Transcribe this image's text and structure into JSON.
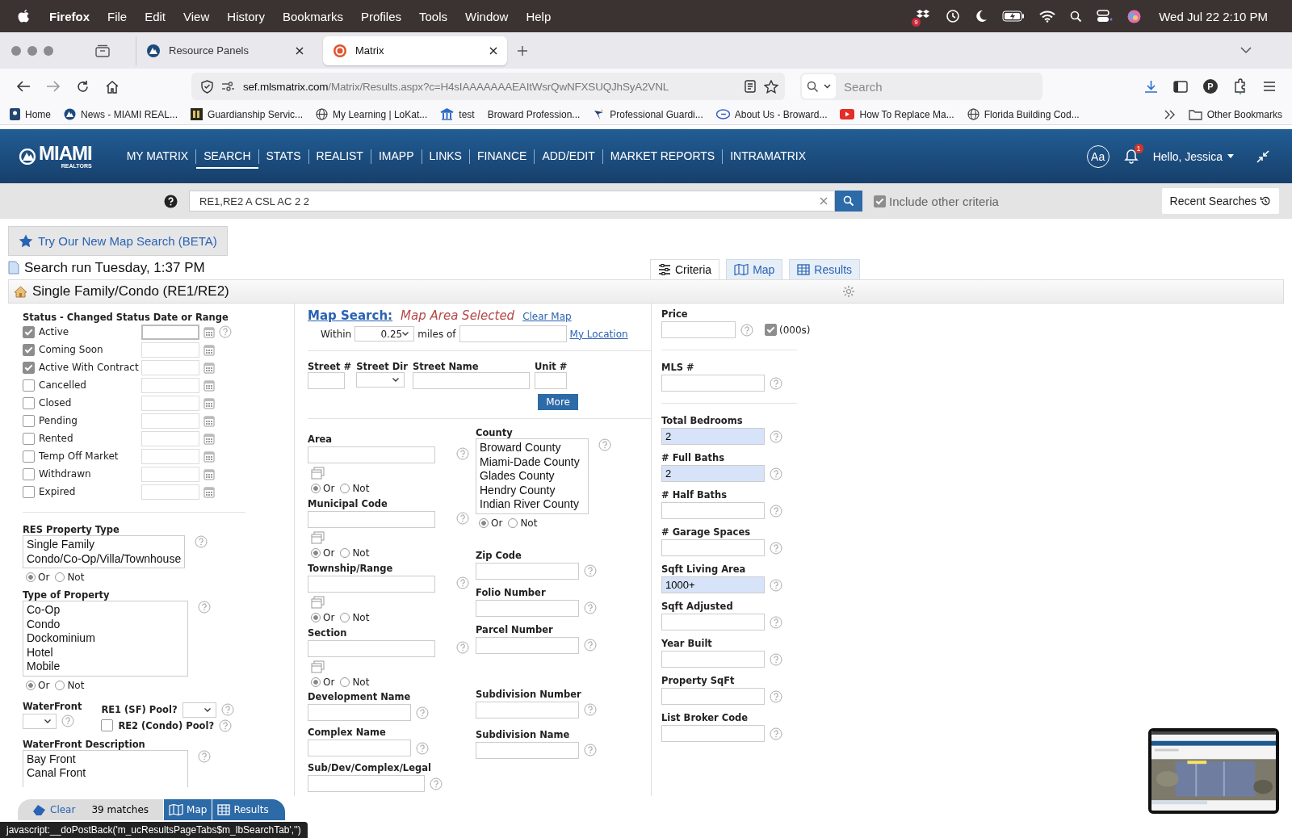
{
  "menubar": {
    "app": "Firefox",
    "menus": [
      "File",
      "Edit",
      "View",
      "History",
      "Bookmarks",
      "Profiles",
      "Tools",
      "Window",
      "Help"
    ],
    "dropbox_badge": "9",
    "clock": "Wed Jul 22  2:10 PM"
  },
  "tabs": [
    {
      "title": "Resource Panels",
      "selected": false
    },
    {
      "title": "Matrix",
      "selected": true
    }
  ],
  "address": {
    "domain": "sef.mlsmatrix.com",
    "path": "/Matrix/Results.aspx?c=H4sIAAAAAAAEAItWsrQwNFXSUQJhSyA2VNL",
    "search_placeholder": "Search",
    "profile": "P"
  },
  "bookmarks": [
    "Home",
    "News - MIAMI REAL...",
    "Guardianship Servic...",
    "My Learning | LoKat...",
    "test",
    "Broward Profession...",
    "Professional Guardi...",
    "About Us - Broward...",
    "How To Replace Ma...",
    "Florida Building Cod..."
  ],
  "other_bookmarks": "Other Bookmarks",
  "header": {
    "logo": "MIAMI",
    "logo_sub": "REALTORS",
    "nav": [
      {
        "label": "MY MATRIX",
        "selected": false
      },
      {
        "label": "SEARCH",
        "selected": true
      },
      {
        "label": "STATS",
        "selected": false
      },
      {
        "label": "REALIST",
        "selected": false
      },
      {
        "label": "IMAPP",
        "selected": false
      },
      {
        "label": "LINKS",
        "selected": false
      },
      {
        "label": "FINANCE",
        "selected": false
      },
      {
        "label": "ADD/EDIT",
        "selected": false
      },
      {
        "label": "MARKET REPORTS",
        "selected": false
      },
      {
        "label": "INTRAMATRIX",
        "selected": false
      }
    ],
    "text_size": "Aa",
    "notifications": "1",
    "user": "Hello, Jessica"
  },
  "quick_search": {
    "value": "RE1,RE2 A CSL AC 2 2",
    "include_label": "Include other criteria",
    "include_checked": true,
    "recent": "Recent Searches"
  },
  "beta_button": "Try Our New Map Search (BETA)",
  "search_run": "Search run Tuesday, 1:37 PM",
  "view_tabs": [
    {
      "label": "Criteria",
      "selected": true
    },
    {
      "label": "Map",
      "selected": false
    },
    {
      "label": "Results",
      "selected": false
    }
  ],
  "section_title": "Single Family/Condo (RE1/RE2)",
  "status": {
    "title": "Status - Changed Status Date or Range",
    "items": [
      {
        "label": "Active",
        "checked": true
      },
      {
        "label": "Coming Soon",
        "checked": true
      },
      {
        "label": "Active With Contract",
        "checked": true
      },
      {
        "label": "Cancelled",
        "checked": false
      },
      {
        "label": "Closed",
        "checked": false
      },
      {
        "label": "Pending",
        "checked": false
      },
      {
        "label": "Rented",
        "checked": false
      },
      {
        "label": "Temp Off Market",
        "checked": false
      },
      {
        "label": "Withdrawn",
        "checked": false
      },
      {
        "label": "Expired",
        "checked": false
      }
    ]
  },
  "res_property_type": {
    "label": "RES Property Type",
    "options": [
      "Single Family",
      "Condo/Co-Op/Villa/Townhouse"
    ],
    "radios": [
      {
        "label": "Or",
        "selected": true
      },
      {
        "label": "Not",
        "selected": false
      }
    ]
  },
  "type_of_property": {
    "label": "Type of Property",
    "options": [
      "Co-Op",
      "Condo",
      "Dockominium",
      "Hotel",
      "Mobile"
    ],
    "radios": [
      {
        "label": "Or",
        "selected": true
      },
      {
        "label": "Not",
        "selected": false
      }
    ]
  },
  "waterfront": {
    "label": "WaterFront",
    "re1_pool": "RE1 (SF) Pool?",
    "re2_pool": "RE2 (Condo) Pool?",
    "re2_checked": false
  },
  "waterfront_description": {
    "label": "WaterFront Description",
    "options": [
      "Bay Front",
      "Canal Front"
    ]
  },
  "map_search": {
    "title": "Map Search:",
    "status": "Map Area Selected",
    "clear": "Clear Map",
    "within": "Within",
    "distance": "0.25",
    "miles_of": "miles of",
    "my_location": "My Location"
  },
  "street_fields": [
    "Street #",
    "Street Dir",
    "Street Name",
    "Unit #"
  ],
  "more_button": "More",
  "location_fields": [
    {
      "label": "Area",
      "radios": [
        {
          "label": "Or",
          "selected": true
        },
        {
          "label": "Not",
          "selected": false
        }
      ]
    },
    {
      "label": "Municipal Code",
      "radios": [
        {
          "label": "Or",
          "selected": true
        },
        {
          "label": "Not",
          "selected": false
        }
      ]
    },
    {
      "label": "Township/Range",
      "radios": [
        {
          "label": "Or",
          "selected": true
        },
        {
          "label": "Not",
          "selected": false
        }
      ]
    },
    {
      "label": "Section",
      "radios": [
        {
          "label": "Or",
          "selected": true
        },
        {
          "label": "Not",
          "selected": false
        }
      ]
    }
  ],
  "county": {
    "label": "County",
    "options": [
      "Broward County",
      "Miami-Dade County",
      "Glades County",
      "Hendry County",
      "Indian River County"
    ],
    "radios": [
      {
        "label": "Or",
        "selected": true
      },
      {
        "label": "Not",
        "selected": false
      }
    ]
  },
  "id_fields": [
    "Zip Code",
    "Folio Number",
    "Parcel Number"
  ],
  "name_fields_left": [
    "Development Name",
    "Complex Name",
    "Sub/Dev/Complex/Legal"
  ],
  "name_fields_right": [
    "Subdivision Number",
    "Subdivision Name"
  ],
  "price": {
    "label": "Price",
    "unit": "(000s)",
    "unit_checked": true
  },
  "right_fields": [
    {
      "label": "MLS #"
    },
    {
      "label": "Total Bedrooms",
      "value": "2"
    },
    {
      "label": "# Full Baths",
      "value": "2"
    },
    {
      "label": "# Half Baths"
    },
    {
      "label": "# Garage Spaces"
    },
    {
      "label": "Sqft Living Area",
      "value": "1000+"
    },
    {
      "label": "Sqft Adjusted"
    },
    {
      "label": "Year Built"
    },
    {
      "label": "Property SqFt"
    },
    {
      "label": "List Broker Code"
    }
  ],
  "bottom_bar": {
    "clear": "Clear",
    "matches": "39 matches",
    "map": "Map",
    "results": "Results"
  },
  "status_url": "javascript:__doPostBack('m_ucResultsPageTabs$m_lbSearchTab','')",
  "thumbnail": {
    "kind": "picture"
  }
}
